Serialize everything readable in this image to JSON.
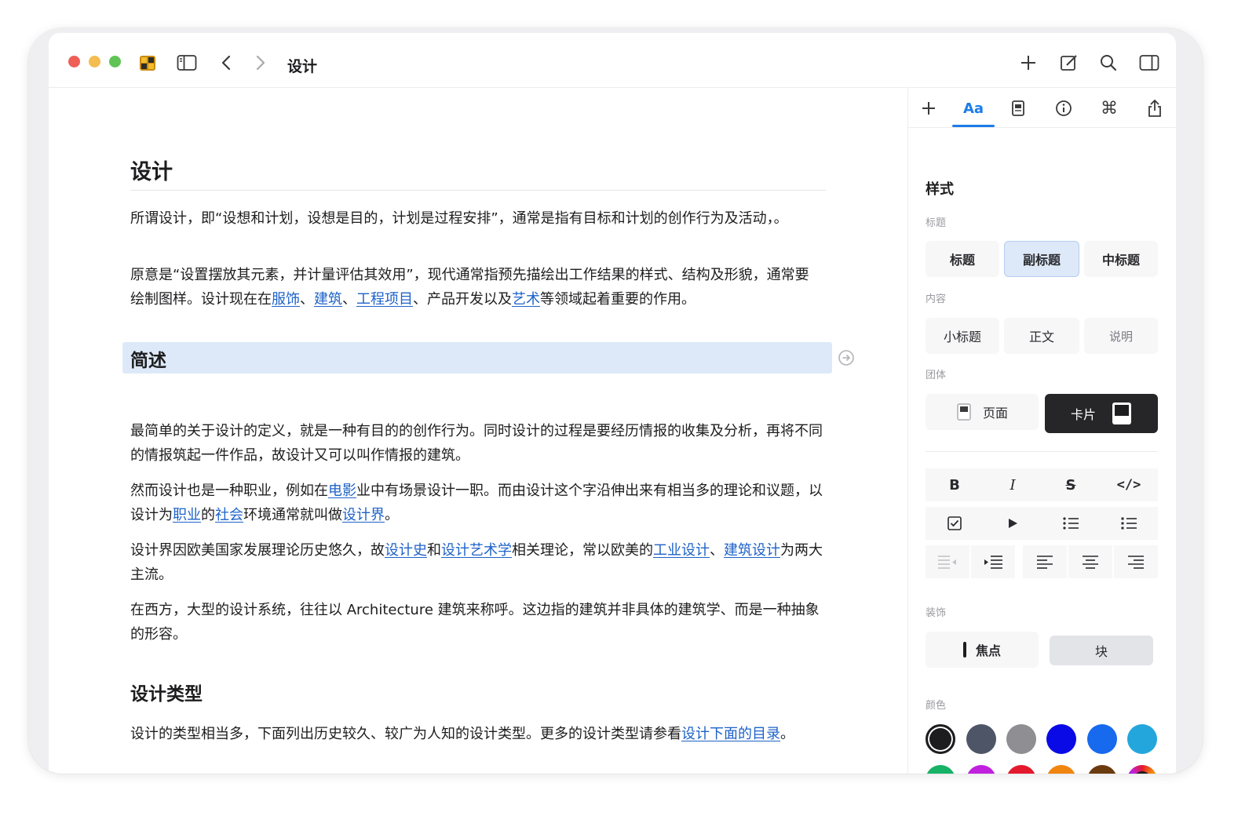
{
  "window": {
    "title": "设计"
  },
  "document": {
    "title": "设计",
    "p1": "所谓设计，即“设想和计划，设想是目的，计划是过程安排”，通常是指有目标和计划的创作行为及活动，。",
    "p2_before": "原意是“设置摆放其元素，并计量评估其效用”，现代通常指预先描绘出工作结果的样式、结构及形貌，通常要绘制图样。设计现在在",
    "p2_link1": "服饰",
    "p2_sep1": "、",
    "p2_link2": "建筑",
    "p2_sep2": "、",
    "p2_link3": "工程项目",
    "p2_mid": "、产品开发以及",
    "p2_link4": "艺术",
    "p2_after": "等领域起着重要的作用。",
    "h2_overview": "简述",
    "p3": "最简单的关于设计的定义，就是一种有目的的创作行为。同时设计的过程是要经历情报的收集及分析，再将不同的情报筑起一件作品，故设计又可以叫作情报的建筑。",
    "p4_before": "然而设计也是一种职业，例如在",
    "p4_link1": "电影",
    "p4_mid1": "业中有场景设计一职。而由设计这个字沿伸出来有相当多的理论和议题，以设计为",
    "p4_link2": "职业",
    "p4_mid2": "的",
    "p4_link3": "社会",
    "p4_mid3": "环境通常就叫做",
    "p4_link4": "设计界",
    "p4_after": "。",
    "p5_before": "设计界因欧美国家发展理论历史悠久，故",
    "p5_link1": "设计史",
    "p5_mid1": "和",
    "p5_link2": "设计艺术学",
    "p5_mid2": "相关理论，常以欧美的",
    "p5_link3": "工业设计",
    "p5_mid3": "、",
    "p5_link4": "建筑设计",
    "p5_after": "为两大主流。",
    "p6": "在西方，大型的设计系统，往往以 Architecture 建筑来称呼。这边指的建筑并非具体的建筑学、而是一种抽象的形容。",
    "h2_types": "设计类型",
    "p7_before": "设计的类型相当多，下面列出历史较久、较广为人知的设计类型。更多的设计类型请参看",
    "p7_link": "设计下面的目录",
    "p7_after": "。"
  },
  "inspector": {
    "tabs": [
      "+",
      "Aa",
      "page-icon",
      "info-icon",
      "command-icon",
      "share-icon"
    ],
    "active_tab": "Aa",
    "title": "样式",
    "heading_label": "标题",
    "heading_options": [
      "标题",
      "副标题",
      "中标题"
    ],
    "heading_selected": "副标题",
    "content_label": "内容",
    "content_options": [
      "小标题",
      "正文",
      "说明"
    ],
    "group_label": "团体",
    "group_options": [
      "页面",
      "卡片"
    ],
    "group_selected": "卡片",
    "format_buttons": [
      "bold",
      "italic",
      "strikethrough",
      "code",
      "checkbox",
      "toggle",
      "bullet-list",
      "numbered-list",
      "outdent",
      "indent",
      "align-left",
      "align-center",
      "align-right"
    ],
    "decoration_label": "装饰",
    "decoration_options": [
      "焦点",
      "块"
    ],
    "decoration_selected": "块",
    "color_label": "颜色",
    "colors_row1": [
      "#1d1d1f",
      "#4d5566",
      "#8e8e93",
      "#0a0ae6",
      "#1769ee",
      "#23a6dc"
    ],
    "colors_row2": [
      "#18b266",
      "#c021df",
      "#e3192d",
      "#f0850f",
      "#6b3a0e",
      "multicolor"
    ],
    "color_selected": "#1d1d1f"
  }
}
